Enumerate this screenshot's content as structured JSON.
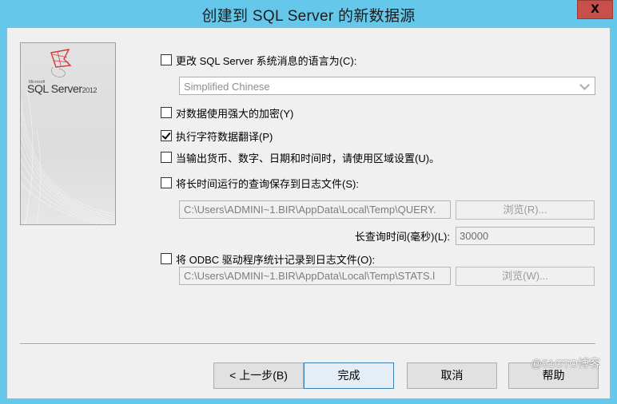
{
  "window": {
    "title": "创建到 SQL Server 的新数据源",
    "close_label": "X"
  },
  "banner": {
    "brand_small": "Microsoft",
    "brand_main": "SQL Server",
    "brand_year": "2012"
  },
  "options": {
    "change_language": {
      "label": "更改 SQL Server 系统消息的语言为(C):",
      "checked": false
    },
    "language_select": {
      "value": "Simplified Chinese"
    },
    "strong_encryption": {
      "label": "对数据使用强大的加密(Y)",
      "checked": false
    },
    "char_translation": {
      "label": "执行字符数据翻译(P)",
      "checked": true
    },
    "regional_settings": {
      "label": "当输出货币、数字、日期和时间时，请使用区域设置(U)。",
      "checked": false
    },
    "log_long_queries": {
      "label": "将长时间运行的查询保存到日志文件(S):",
      "checked": false
    },
    "query_log_path": "C:\\Users\\ADMINI~1.BIR\\AppData\\Local\\Temp\\QUERY.",
    "browse_query_label": "浏览(R)...",
    "long_query_time_label": "长查询时间(毫秒)(L):",
    "long_query_time_value": "30000",
    "log_odbc_stats": {
      "label": "将 ODBC 驱动程序统计记录到日志文件(O):",
      "checked": false
    },
    "stats_log_path": "C:\\Users\\ADMINI~1.BIR\\AppData\\Local\\Temp\\STATS.l",
    "browse_stats_label": "浏览(W)..."
  },
  "buttons": {
    "back": "< 上一步(B)",
    "finish": "完成",
    "cancel": "取消",
    "help": "帮助"
  },
  "watermark": "@51CTO博客"
}
